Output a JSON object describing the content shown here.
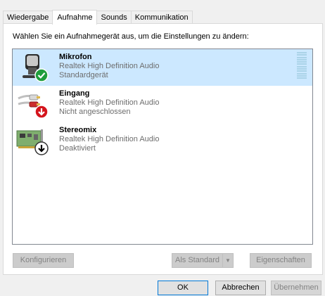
{
  "tabs": [
    "Wiedergabe",
    "Aufnahme",
    "Sounds",
    "Kommunikation"
  ],
  "active_tab": "Aufnahme",
  "instruction": "Wählen Sie ein Aufnahmegerät aus, um die Einstellungen zu ändern:",
  "devices": [
    {
      "name": "Mikrofon",
      "driver": "Realtek High Definition Audio",
      "status": "Standardgerät",
      "selected": true,
      "badge": "check-icon"
    },
    {
      "name": "Eingang",
      "driver": "Realtek High Definition Audio",
      "status": "Nicht angeschlossen",
      "selected": false,
      "badge": "arrow-down-red-icon"
    },
    {
      "name": "Stereomix",
      "driver": "Realtek High Definition Audio",
      "status": "Deaktiviert",
      "selected": false,
      "badge": "arrow-down-black-icon"
    }
  ],
  "buttons": {
    "configure": "Konfigurieren",
    "set_default": "Als Standard",
    "properties": "Eigenschaften",
    "ok": "OK",
    "cancel": "Abbrechen",
    "apply": "Übernehmen"
  },
  "colors": {
    "selection": "#cce8ff",
    "check_green": "#1f9e3c",
    "badge_red": "#d4141c"
  }
}
